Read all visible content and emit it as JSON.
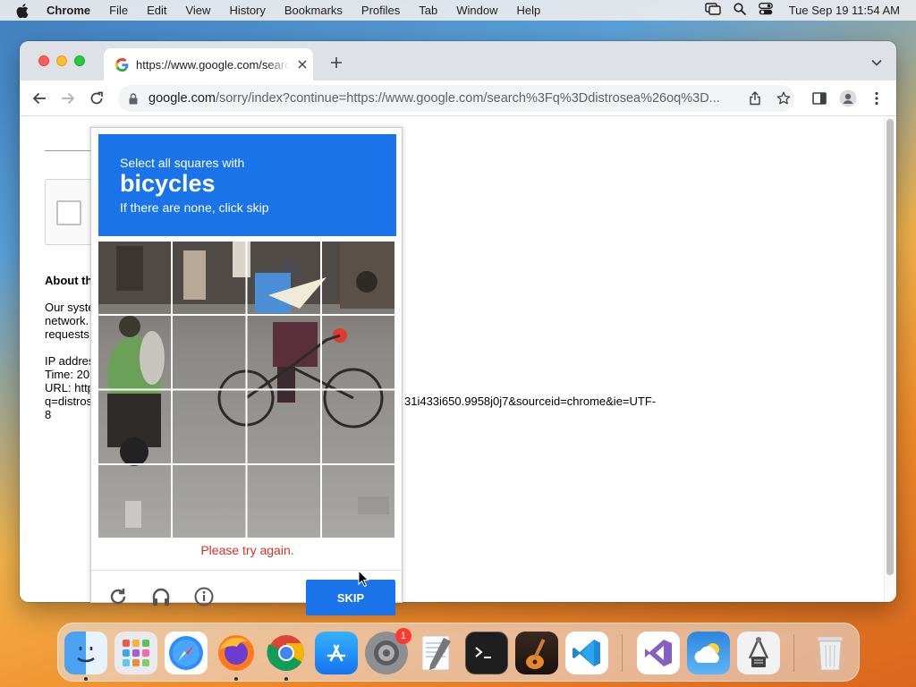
{
  "menubar": {
    "app_name": "Chrome",
    "items": [
      "File",
      "Edit",
      "View",
      "History",
      "Bookmarks",
      "Profiles",
      "Tab",
      "Window",
      "Help"
    ],
    "clock": "Tue Sep 19  11:54 AM"
  },
  "browser": {
    "tab_title": "https://www.google.com/search?q=distrosea",
    "url_host": "google.com",
    "url_path": "/sorry/index?continue=https://www.google.com/search%3Fq%3Ddistrosea%26oq%3D..."
  },
  "page": {
    "about_title": "About th",
    "para_lines": [
      "Our syste",
      "network.",
      "requests"
    ],
    "ip_label": "IP addres",
    "time_label": "Time: 20",
    "url_label": "URL: http",
    "q_label": "q=distros",
    "trailing_8": "8",
    "url_tail": "31i433i650.9958j0j7&sourceid=chrome&ie=UTF-"
  },
  "captcha": {
    "instruction_line1": "Select all squares with",
    "target_word": "bicycles",
    "instruction_line3": "If there are none, click skip",
    "error_text": "Please try again.",
    "skip_label": "SKIP"
  },
  "dock": {
    "apps": [
      "finder-icon",
      "launchpad-icon",
      "safari-icon",
      "firefox-icon",
      "chrome-icon",
      "app-store-icon",
      "system-settings-icon",
      "textedit-icon",
      "terminal-icon",
      "garageband-icon",
      "vscode-icon",
      "visual-studio-icon",
      "weather-icon",
      "scripts-icon",
      "trash-icon"
    ],
    "settings_badge": "1"
  },
  "colors": {
    "captcha_blue": "#1a73e8",
    "error_red": "#d93025"
  }
}
